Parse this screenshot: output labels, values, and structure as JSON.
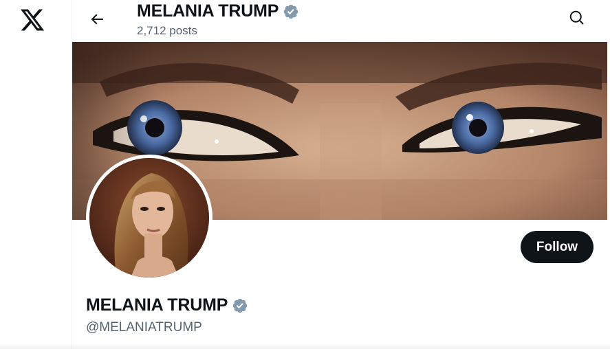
{
  "nav": {
    "logo_icon": "x-logo-icon"
  },
  "header": {
    "back_icon": "arrow-left-icon",
    "title": "MELANIA TRUMP",
    "posts_count": "2,712 posts",
    "search_icon": "search-icon"
  },
  "profile": {
    "display_name": "MELANIA TRUMP",
    "handle": "@MELANIATRUMP",
    "verified_icon": "verified-badge-icon",
    "follow_label": "Follow"
  },
  "colors": {
    "text_primary": "#0f1419",
    "text_secondary": "#536471",
    "verified_badge": "#829aab",
    "follow_bg": "#0f1419",
    "follow_text": "#ffffff"
  }
}
